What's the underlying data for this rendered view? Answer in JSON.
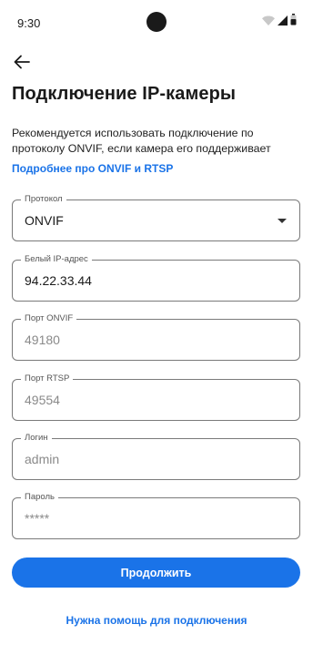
{
  "status_bar": {
    "time": "9:30",
    "icons": [
      "wifi-icon",
      "cellular-signal-icon",
      "battery-icon"
    ]
  },
  "header": {
    "back_icon": "arrow-left-icon",
    "title": "Подключение IP-камеры"
  },
  "intro": {
    "hint": "Рекомендуется использовать подключение по протоколу ONVIF, если камера его поддерживает",
    "link": "Подробнее про ONVIF и RTSP"
  },
  "form": {
    "protocol": {
      "label": "Протокол",
      "value": "ONVIF"
    },
    "ip_address": {
      "label": "Белый IP-адрес",
      "value": "94.22.33.44"
    },
    "onvif_port": {
      "label": "Порт ONVIF",
      "placeholder": "49180"
    },
    "rtsp_port": {
      "label": "Порт RTSP",
      "placeholder": "49554"
    },
    "login": {
      "label": "Логин",
      "placeholder": "admin"
    },
    "password": {
      "label": "Пароль",
      "placeholder": "*****"
    }
  },
  "actions": {
    "continue_label": "Продолжить",
    "help_label": "Нужна помощь для подключения"
  },
  "colors": {
    "accent": "#1a73e8",
    "text": "#1a1a1a",
    "border": "#7a7a7a",
    "placeholder": "#8a8a8a"
  }
}
